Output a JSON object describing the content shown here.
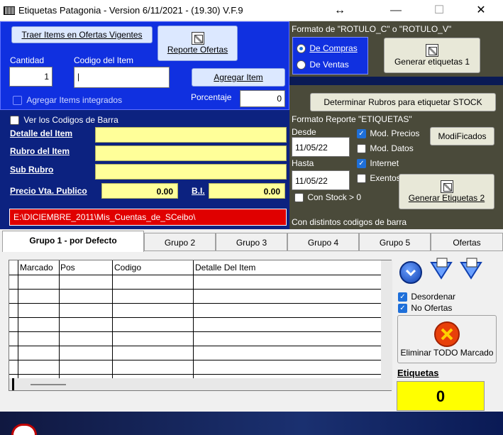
{
  "window": {
    "title": "Etiquetas Patagonia - Version 6/11/2021 - (19.30)  V.F.9",
    "resize_glyph": "↔",
    "minimize_glyph": "—",
    "maximize_glyph": "☐",
    "close_glyph": "✕"
  },
  "left_panel": {
    "traer_button": "Traer Items en Ofertas Vigentes",
    "reporte_button": "Reporte Ofertas",
    "cantidad_label": "Cantidad",
    "cantidad_value": "1",
    "codigo_label": "Codigo del Item",
    "codigo_value": "|",
    "agregar_button": "Agregar Item",
    "porcentaje_label": "Porcentaje",
    "porcentaje_value": "0",
    "agregar_integrados_label": "Agregar Items integrados",
    "ver_codigos_label": "Ver los Codigos de Barra",
    "detalle_label": "Detalle del Item",
    "rubro_label": "Rubro del Item",
    "subrubro_label": "Sub Rubro",
    "precio_label": "Precio Vta. Publico",
    "precio_value": "0.00",
    "bi_label": "B.I.",
    "bi_value": "0.00",
    "path_value": "E:\\DICIEMBRE_2011\\Mis_Cuentas_de_SCeibo\\"
  },
  "right_panel": {
    "formato_title": "Formato de \"ROTULO_C\" o \"ROTULO_V\"",
    "radio_compras": "De Compras",
    "radio_ventas": "De Ventas",
    "generar1_button": "Generar etiquetas 1",
    "determinar_button": "Determinar Rubros para etiquetar STOCK",
    "formato_reporte_title": "Formato Reporte \"ETIQUETAS\"",
    "desde_label": "Desde",
    "desde_value": "11/05/22",
    "hasta_label": "Hasta",
    "hasta_value": "11/05/22",
    "mod_precios": "Mod. Precios",
    "mod_datos": "Mod. Datos",
    "internet": "Internet",
    "exentos": "Exentos",
    "modificados_button": "ModiFicados",
    "con_stock": "Con Stock > 0",
    "generar2_button": "Generar Etiquetas 2",
    "distintos_label": "Con distintos codigos de barra"
  },
  "tabs": [
    "Grupo 1 - por Defecto",
    "Grupo 2",
    "Grupo 3",
    "Grupo 4",
    "Grupo 5",
    "Ofertas"
  ],
  "grid": {
    "columns": [
      "Marcado",
      "Pos",
      "Codigo",
      "Detalle Del Item"
    ]
  },
  "side": {
    "desordenar": "Desordenar",
    "no_ofertas": "No Ofertas",
    "eliminar_button": "Eliminar TODO Marcado",
    "etiquetas_label": "Etiquetas",
    "etiquetas_value": "0"
  }
}
